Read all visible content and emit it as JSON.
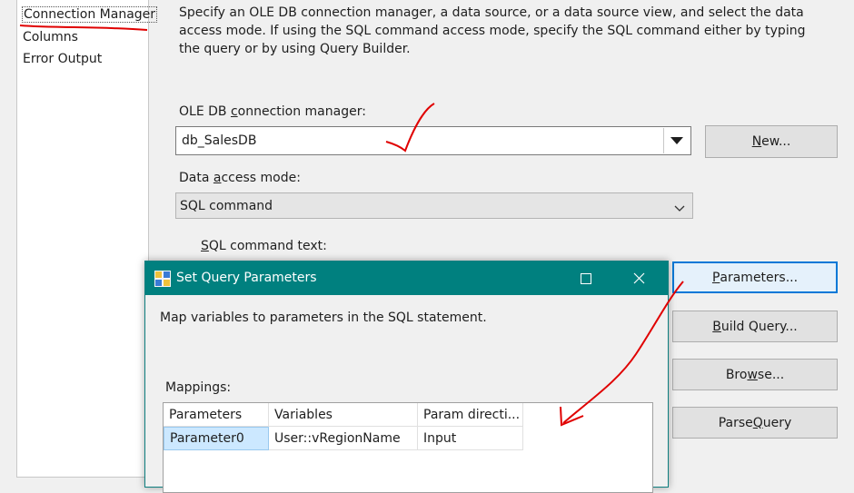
{
  "nav": {
    "items": [
      "Connection Manager",
      "Columns",
      "Error Output"
    ]
  },
  "description": "Specify an OLE DB connection manager, a data source, or a data source view, and select the data access mode. If using the SQL command access mode, specify the SQL command either by typing the query or by using Query Builder.",
  "conn": {
    "label_pre": "OLE DB ",
    "label_ul": "c",
    "label_post": "onnection manager:",
    "value": "db_SalesDB",
    "new_ul": "N",
    "new_rest": "ew..."
  },
  "access": {
    "label_pre": "Data ",
    "label_ul": "a",
    "label_post": "ccess mode:",
    "value": "SQL command"
  },
  "sql": {
    "label_ul": "S",
    "label_rest": "QL command text:"
  },
  "buttons": {
    "parameters_ul": "P",
    "parameters_rest": "arameters...",
    "build_ul": "B",
    "build_rest": "uild Query...",
    "browse_pre": "Bro",
    "browse_ul": "w",
    "browse_post": "se...",
    "parse_pre": "Parse ",
    "parse_ul": "Q",
    "parse_post": "uery"
  },
  "dialog": {
    "title": "Set Query Parameters",
    "instructions": "Map variables to parameters in the SQL statement.",
    "mappings_label": "Mappings:",
    "columns": [
      "Parameters",
      "Variables",
      "Param directi..."
    ],
    "rows": [
      {
        "parameter": "Parameter0",
        "variable": "User::vRegionName",
        "direction": "Input"
      }
    ]
  },
  "colors": {
    "titlebar": "#00807f",
    "focus_border": "#0078d7",
    "annotation": "#e00000"
  }
}
